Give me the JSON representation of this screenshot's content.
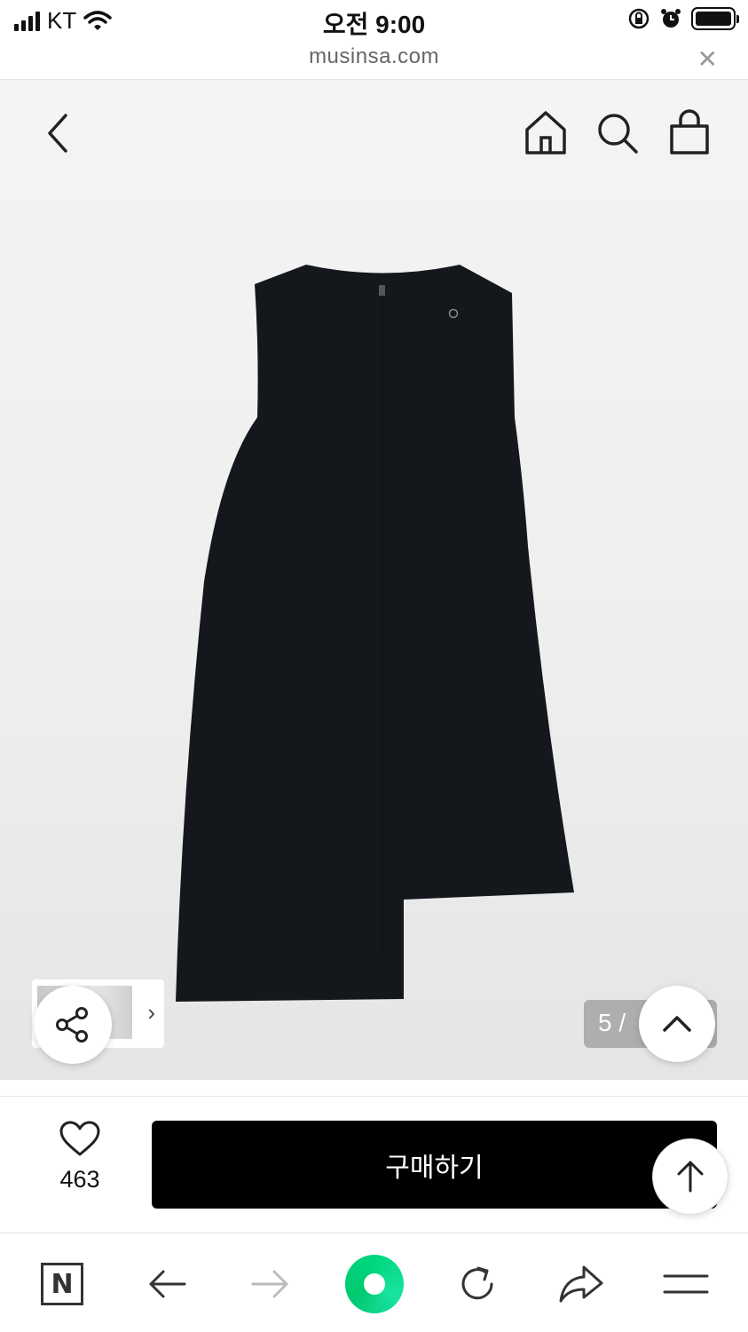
{
  "status_bar": {
    "carrier": "KT",
    "time": "오전 9:00"
  },
  "browser": {
    "url": "musinsa.com",
    "close_glyph": "✕"
  },
  "header": {
    "icons": [
      "back-icon",
      "home-icon",
      "search-icon",
      "shopping-bag-icon"
    ]
  },
  "gallery": {
    "page_counter": "5 /",
    "thumbnail_chevron": "›"
  },
  "purchase": {
    "like_count": "463",
    "buy_label": "구매하기"
  },
  "toolbar": {
    "n_label": "N",
    "icons": [
      "naver-n-icon",
      "back-arrow-icon",
      "forward-arrow-icon",
      "green-dot-icon",
      "reload-icon",
      "share-arrow-icon",
      "menu-icon"
    ]
  },
  "colors": {
    "buy_button": "#000000",
    "green_dot": "#00d77e",
    "hero_background": "#f0f0f0"
  }
}
